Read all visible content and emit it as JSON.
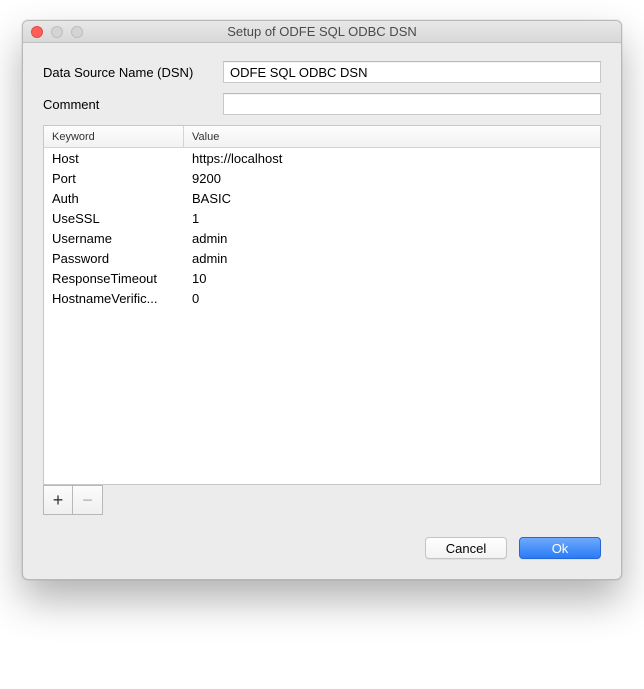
{
  "window": {
    "title": "Setup of ODFE SQL ODBC DSN"
  },
  "form": {
    "dsn_label": "Data Source Name (DSN)",
    "dsn_value": "ODFE SQL ODBC DSN",
    "comment_label": "Comment",
    "comment_value": ""
  },
  "table": {
    "headers": {
      "keyword": "Keyword",
      "value": "Value"
    },
    "rows": [
      {
        "keyword": "Host",
        "value": "https://localhost"
      },
      {
        "keyword": "Port",
        "value": "9200"
      },
      {
        "keyword": "Auth",
        "value": "BASIC"
      },
      {
        "keyword": "UseSSL",
        "value": "1"
      },
      {
        "keyword": "Username",
        "value": "admin"
      },
      {
        "keyword": "Password",
        "value": "admin"
      },
      {
        "keyword": "ResponseTimeout",
        "value": "10"
      },
      {
        "keyword": "HostnameVerific...",
        "value": "0"
      }
    ]
  },
  "buttons": {
    "add": "+",
    "remove": "−",
    "cancel": "Cancel",
    "ok": "Ok"
  }
}
